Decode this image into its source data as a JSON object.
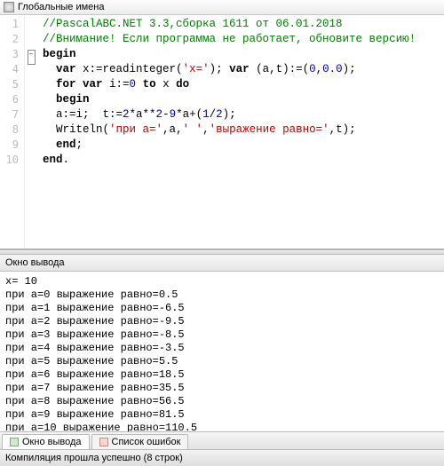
{
  "titlebar": {
    "text": "Глобальные имена"
  },
  "code": {
    "lines": [
      {
        "n": 1,
        "seg": [
          {
            "cls": "c-comment",
            "t": "//PascalABC.NET 3.3,сборка 1611 от 06.01.2018"
          }
        ]
      },
      {
        "n": 2,
        "seg": [
          {
            "cls": "c-comment",
            "t": "//Внимание! Если программа не работает, обновите версию!"
          }
        ]
      },
      {
        "n": 3,
        "fold": true,
        "seg": [
          {
            "cls": "c-kw",
            "t": "begin"
          }
        ]
      },
      {
        "n": 4,
        "seg": [
          {
            "cls": "",
            "t": "  "
          },
          {
            "cls": "c-kw",
            "t": "var"
          },
          {
            "cls": "",
            "t": " x:=readinteger("
          },
          {
            "cls": "c-str",
            "t": "'x='"
          },
          {
            "cls": "",
            "t": "); "
          },
          {
            "cls": "c-kw",
            "t": "var"
          },
          {
            "cls": "",
            "t": " (a,t):=("
          },
          {
            "cls": "c-num",
            "t": "0"
          },
          {
            "cls": "",
            "t": ","
          },
          {
            "cls": "c-num",
            "t": "0.0"
          },
          {
            "cls": "",
            "t": ");"
          }
        ]
      },
      {
        "n": 5,
        "seg": [
          {
            "cls": "",
            "t": "  "
          },
          {
            "cls": "c-kw",
            "t": "for var"
          },
          {
            "cls": "",
            "t": " i:="
          },
          {
            "cls": "c-num",
            "t": "0"
          },
          {
            "cls": "",
            "t": " "
          },
          {
            "cls": "c-kw",
            "t": "to"
          },
          {
            "cls": "",
            "t": " x "
          },
          {
            "cls": "c-kw",
            "t": "do"
          }
        ]
      },
      {
        "n": 6,
        "seg": [
          {
            "cls": "",
            "t": "  "
          },
          {
            "cls": "c-kw",
            "t": "begin"
          }
        ]
      },
      {
        "n": 7,
        "seg": [
          {
            "cls": "",
            "t": "  a:=i;  t:="
          },
          {
            "cls": "c-num",
            "t": "2"
          },
          {
            "cls": "",
            "t": "*a**"
          },
          {
            "cls": "c-num",
            "t": "2"
          },
          {
            "cls": "",
            "t": "-"
          },
          {
            "cls": "c-num",
            "t": "9"
          },
          {
            "cls": "",
            "t": "*a+("
          },
          {
            "cls": "c-num",
            "t": "1"
          },
          {
            "cls": "",
            "t": "/"
          },
          {
            "cls": "c-num",
            "t": "2"
          },
          {
            "cls": "",
            "t": ");"
          }
        ]
      },
      {
        "n": 8,
        "seg": [
          {
            "cls": "",
            "t": "  Writeln("
          },
          {
            "cls": "c-str",
            "t": "'при a='"
          },
          {
            "cls": "",
            "t": ",a,"
          },
          {
            "cls": "c-str",
            "t": "' '"
          },
          {
            "cls": "",
            "t": ","
          },
          {
            "cls": "c-str",
            "t": "'выражение равно='"
          },
          {
            "cls": "",
            "t": ",t);"
          }
        ]
      },
      {
        "n": 9,
        "seg": [
          {
            "cls": "",
            "t": "  "
          },
          {
            "cls": "c-kw",
            "t": "end"
          },
          {
            "cls": "",
            "t": ";"
          }
        ]
      },
      {
        "n": 10,
        "seg": [
          {
            "cls": "c-kw",
            "t": "end"
          },
          {
            "cls": "",
            "t": "."
          }
        ]
      }
    ]
  },
  "outpanel": {
    "title": "Окно вывода",
    "lines": [
      "x= 10",
      "при a=0 выражение равно=0.5",
      "при a=1 выражение равно=-6.5",
      "при a=2 выражение равно=-9.5",
      "при a=3 выражение равно=-8.5",
      "при a=4 выражение равно=-3.5",
      "при a=5 выражение равно=5.5",
      "при a=6 выражение равно=18.5",
      "при a=7 выражение равно=35.5",
      "при a=8 выражение равно=56.5",
      "при a=9 выражение равно=81.5",
      "при a=10 выражение равно=110.5"
    ]
  },
  "tabs": {
    "output": "Окно вывода",
    "errors": "Список ошибок"
  },
  "status": {
    "text": "Компиляция прошла успешно (8 строк)"
  }
}
